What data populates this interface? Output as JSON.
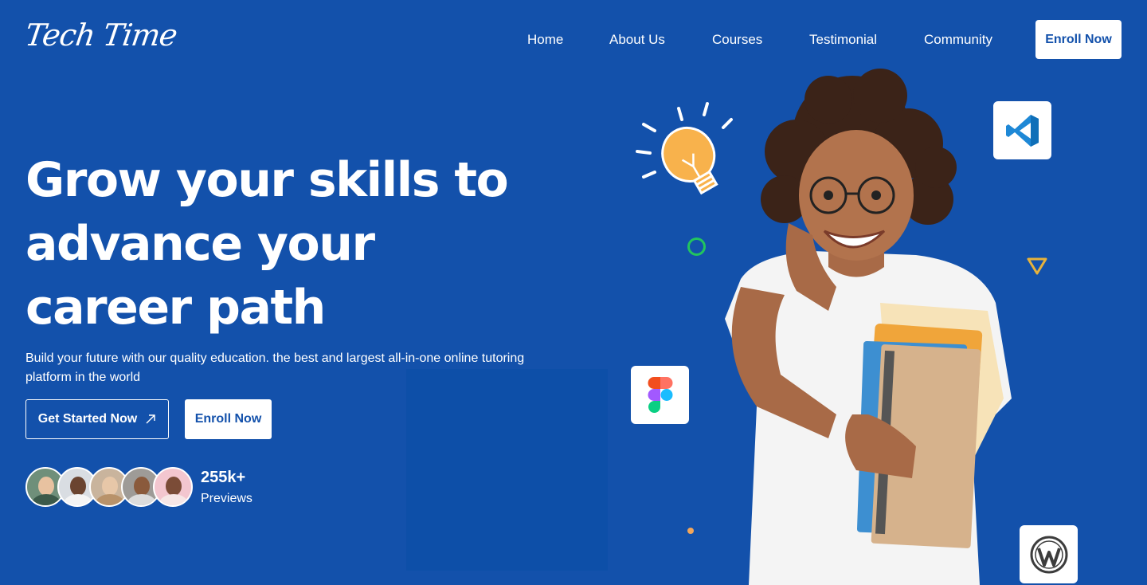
{
  "brand": {
    "logo_text": "Tech Time"
  },
  "nav": {
    "items": [
      {
        "label": "Home"
      },
      {
        "label": "About Us"
      },
      {
        "label": "Courses"
      },
      {
        "label": "Testimonial"
      },
      {
        "label": "Community"
      }
    ],
    "enroll_label": "Enroll Now"
  },
  "hero": {
    "title": "Grow your skills to advance your career path",
    "subtitle": "Build your future with our quality education. the best and largest all-in-one online tutoring platform in the world",
    "primary_button": "Get Started Now",
    "secondary_button": "Enroll Now"
  },
  "stats": {
    "count": "255k+",
    "label": "Previews"
  },
  "icons": {
    "tiles": [
      "vscode-icon",
      "figma-icon",
      "wordpress-icon"
    ],
    "arrow": "arrow-up-right-icon"
  },
  "colors": {
    "background": "#1351ab",
    "accent_green": "#22c55e",
    "accent_yellow": "#f4b942",
    "vscode_blue": "#1e88d6"
  }
}
